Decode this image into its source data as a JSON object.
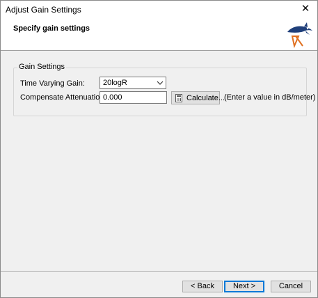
{
  "window": {
    "title": "Adjust Gain Settings",
    "close_glyph": "✕"
  },
  "header": {
    "title": "Specify gain settings",
    "logo_icon": "sonar-logo-icon"
  },
  "gain_settings": {
    "group_label": "Gain Settings",
    "tvg_label": "Time Varying Gain:",
    "tvg_value": "20logR",
    "attenuation_label": "Compensate Attenuation:",
    "attenuation_value": "0.000",
    "calculate_label": "Calculate...",
    "hint": "(Enter a value in dB/meter)"
  },
  "footer": {
    "back_label": "< Back",
    "next_label": "Next >",
    "cancel_label": "Cancel"
  },
  "colors": {
    "accent": "#0078d7",
    "logo_blue": "#1f3f7a",
    "logo_orange": "#e07020"
  }
}
